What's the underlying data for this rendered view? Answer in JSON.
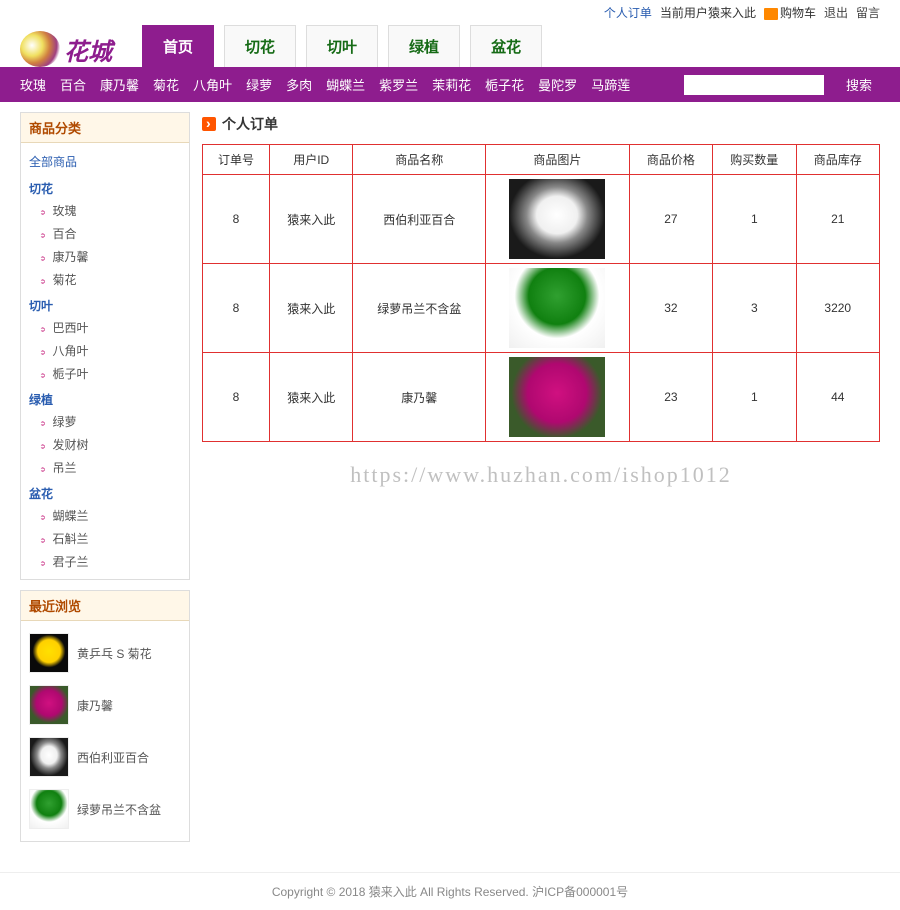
{
  "topbar": {
    "personal_order": "个人订单",
    "current_user_prefix": "当前用户",
    "current_user": "猿来入此",
    "cart": "购物车",
    "logout": "退出",
    "message": "留言"
  },
  "logo_text": "花城",
  "main_tabs": [
    {
      "label": "首页",
      "active": true
    },
    {
      "label": "切花",
      "active": false
    },
    {
      "label": "切叶",
      "active": false
    },
    {
      "label": "绿植",
      "active": false
    },
    {
      "label": "盆花",
      "active": false
    }
  ],
  "nav_items": [
    "玫瑰",
    "百合",
    "康乃馨",
    "菊花",
    "八角叶",
    "绿萝",
    "多肉",
    "蝴蝶兰",
    "紫罗兰",
    "茉莉花",
    "栀子花",
    "曼陀罗",
    "马蹄莲"
  ],
  "search_btn": "搜索",
  "sidebar": {
    "categories_title": "商品分类",
    "all_label": "全部商品",
    "groups": [
      {
        "name": "切花",
        "items": [
          "玫瑰",
          "百合",
          "康乃馨",
          "菊花"
        ]
      },
      {
        "name": "切叶",
        "items": [
          "巴西叶",
          "八角叶",
          "栀子叶"
        ]
      },
      {
        "name": "绿植",
        "items": [
          "绿萝",
          "发财树",
          "吊兰"
        ]
      },
      {
        "name": "盆花",
        "items": [
          "蝴蝶兰",
          "石斛兰",
          "君子兰"
        ]
      }
    ],
    "recent_title": "最近浏览",
    "recent": [
      {
        "name": "黄乒乓 S 菊花",
        "cls": "th-yellow"
      },
      {
        "name": "康乃馨",
        "cls": "th-pink"
      },
      {
        "name": "西伯利亚百合",
        "cls": "th-white"
      },
      {
        "name": "绿萝吊兰不含盆",
        "cls": "th-green"
      }
    ]
  },
  "content": {
    "title": "个人订单",
    "headers": [
      "订单号",
      "用户ID",
      "商品名称",
      "商品图片",
      "商品价格",
      "购买数量",
      "商品库存"
    ],
    "rows": [
      {
        "order_id": "8",
        "user": "猿来入此",
        "product": "西伯利亚百合",
        "img_cls": "th-white",
        "price": "27",
        "qty": "1",
        "stock": "21"
      },
      {
        "order_id": "8",
        "user": "猿来入此",
        "product": "绿萝吊兰不含盆",
        "img_cls": "th-green",
        "price": "32",
        "qty": "3",
        "stock": "3220"
      },
      {
        "order_id": "8",
        "user": "猿来入此",
        "product": "康乃馨",
        "img_cls": "th-pink",
        "price": "23",
        "qty": "1",
        "stock": "44"
      }
    ]
  },
  "watermark": "https://www.huzhan.com/ishop1012",
  "footer": "Copyright © 2018 猿来入此 All Rights Reserved.  沪ICP备000001号"
}
